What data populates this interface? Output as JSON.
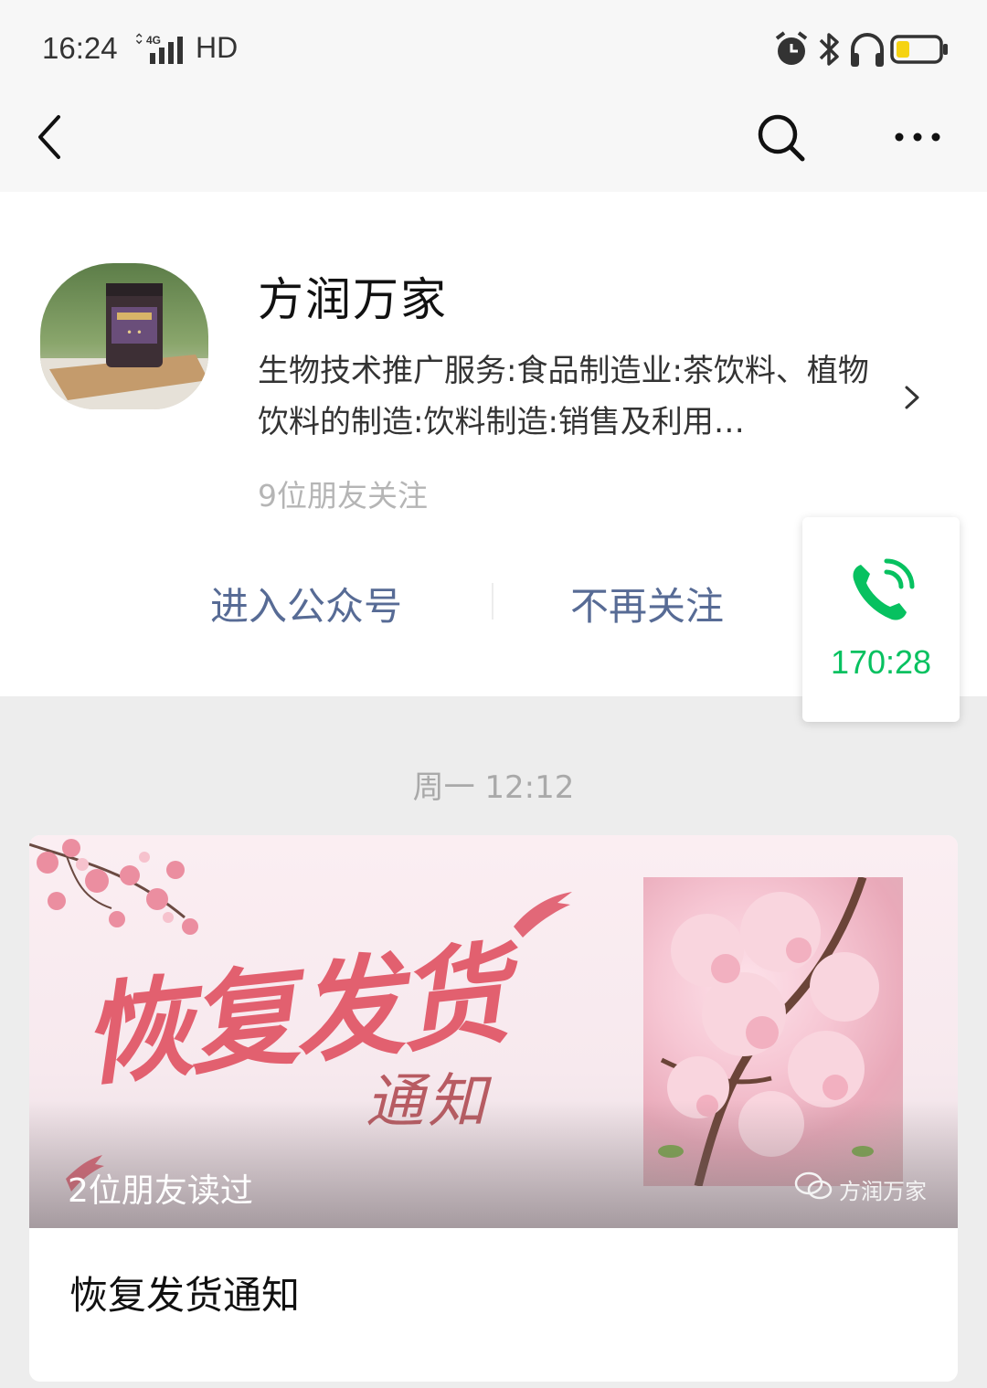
{
  "status_bar": {
    "time": "16:24",
    "network": "4G",
    "hd": "HD",
    "icons": [
      "signal-icon",
      "alarm-icon",
      "bluetooth-icon",
      "headphones-icon",
      "battery-icon"
    ],
    "battery_color": "#f5d312"
  },
  "nav": {
    "icons": [
      "back-icon",
      "search-icon",
      "more-icon"
    ]
  },
  "profile": {
    "name": "方润万家",
    "description": "生物技术推广服务:食品制造业:茶饮料、植物饮料的制造:饮料制造:销售及利用…",
    "followers": "9位朋友关注"
  },
  "actions": {
    "enter": "进入公众号",
    "unfollow": "不再关注"
  },
  "call": {
    "timer": "170:28",
    "color": "#07c160"
  },
  "message": {
    "time": "周一 12:12",
    "cover_text_line1": "恢复发货",
    "cover_text_line2": "通知",
    "readers": "2位朋友读过",
    "watermark": "方润万家",
    "title": "恢复发货通知"
  },
  "colors": {
    "link": "#576b95",
    "muted": "#b5b5b5",
    "background": "#ededed"
  }
}
